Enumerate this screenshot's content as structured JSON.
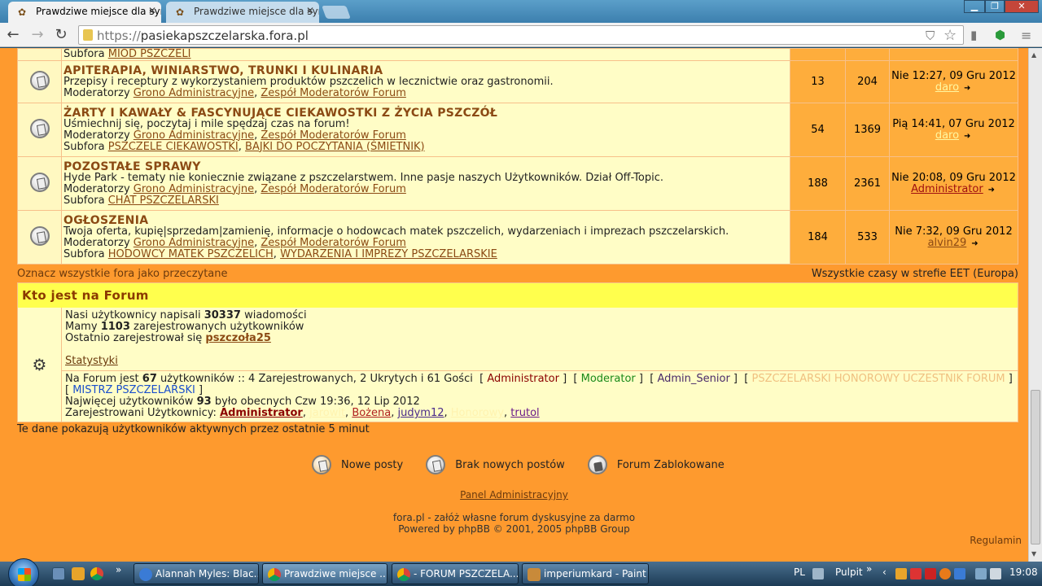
{
  "browser": {
    "tabs": [
      {
        "title": "Prawdziwe miejsce dla syn",
        "active": true
      },
      {
        "title": "Prawdziwe miejsce dla syn",
        "active": false
      }
    ],
    "url_proto": "https://",
    "url_host": "pasiekapszczelarska.fora.pl"
  },
  "forum": {
    "top_partial": {
      "label": "Subfora",
      "sub": "MIÓD PSZCZELI"
    },
    "rows": [
      {
        "title": "APITERAPIA, WINIARSTWO, TRUNKI I KULINARIA",
        "desc": "Przepisy i receptury z wykorzystaniem produktów pszczelich w lecznictwie oraz gastronomii.",
        "mod_label": "Moderatorzy",
        "mods": [
          "Grono Administracyjne",
          "Zespół Moderatorów Forum"
        ],
        "topics": "13",
        "posts": "204",
        "last_date": "Nie 12:27, 09 Gru 2012",
        "last_user": "daro",
        "last_user_color": "#fff7a0"
      },
      {
        "title": "ŻARTY I KAWAŁY & FASCYNUJĄCE CIEKAWOSTKI Z ŻYCIA PSZCZÓŁ",
        "desc": "Uśmiechnij się, poczytaj i mile spędzaj czas na forum!",
        "mod_label": "Moderatorzy",
        "mods": [
          "Grono Administracyjne",
          "Zespół Moderatorów Forum"
        ],
        "sub_label": "Subfora",
        "subs": [
          "PSZCZELE CIEKAWOSTKI",
          "BAJKI DO POCZYTANIA (ŚMIETNIK)"
        ],
        "topics": "54",
        "posts": "1369",
        "last_date": "Pią 14:41, 07 Gru 2012",
        "last_user": "daro",
        "last_user_color": "#fff7a0"
      },
      {
        "title": "POZOSTAŁE SPRAWY",
        "desc": "Hyde Park - tematy nie koniecznie związane z pszczelarstwem. Inne pasje naszych Użytkowników. Dział Off-Topic.",
        "mod_label": "Moderatorzy",
        "mods": [
          "Grono Administracyjne",
          "Zespół Moderatorów Forum"
        ],
        "sub_label": "Subfora",
        "subs": [
          "CHAT PSZCZELARSKI"
        ],
        "topics": "188",
        "posts": "2361",
        "last_date": "Nie 20:08, 09 Gru 2012",
        "last_user": "Administrator",
        "last_user_color": "#a01010"
      },
      {
        "title": "OGŁOSZENIA",
        "desc": "Twoja oferta, kupię|sprzedam|zamienię, informacje o hodowcach matek pszczelich, wydarzeniach i imprezach pszczelarskich.",
        "mod_label": "Moderatorzy",
        "mods": [
          "Grono Administracyjne",
          "Zespół Moderatorów Forum"
        ],
        "sub_label": "Subfora",
        "subs": [
          "HODOWCY MATEK PSZCZELICH",
          "WYDARZENIA I IMPREZY PSZCZELARSKIE"
        ],
        "topics": "184",
        "posts": "533",
        "last_date": "Nie 7:32, 09 Gru 2012",
        "last_user": "alvin29",
        "last_user_color": "#8b4a14"
      }
    ],
    "mark_all": "Oznacz wszystkie fora jako przeczytane",
    "timezone": "Wszystkie czasy w strefie EET (Europa)"
  },
  "who": {
    "heading": "Kto jest na Forum",
    "posts_pre": "Nasi użytkownicy napisali",
    "posts_count": "30337",
    "posts_post": "wiadomości",
    "users_pre": "Mamy",
    "users_count": "1103",
    "users_post": "zarejestrowanych użytkowników",
    "newest_pre": "Ostatnio zarejestrował się",
    "newest_user": "pszczoła25",
    "stats_link": "Statystyki",
    "online_pre": "Na Forum jest",
    "online_count": "67",
    "online_post": "użytkowników :: 4 Zarejestrowanych, 2 Ukrytych i 61 Gości",
    "groups": {
      "admin": "Administrator",
      "mod": "Moderator",
      "senior": "Admin_Senior",
      "ghost": "PSZCZELARSKI HONOROWY UCZESTNIK FORUM",
      "master": "MISTRZ PSZCZELARSKI"
    },
    "record_pre": "Najwięcej użytkowników",
    "record_count": "93",
    "record_post": "było obecnych Czw 19:36, 12 Lip 2012",
    "registered_label": "Zarejestrowani Użytkownicy:",
    "registered": {
      "admin": "Administrator",
      "ghost1": "jarowit",
      "boz": "Bożena",
      "jud": "judym12",
      "ghost2": "Honorowy",
      "trut": "trutol"
    },
    "active_note": "Te dane pokazują użytkowników aktywnych przez ostatnie 5 minut"
  },
  "legend": {
    "new_posts": "Nowe posty",
    "no_new_posts": "Brak nowych postów",
    "locked": "Forum Zablokowane"
  },
  "footer": {
    "admin_panel": "Panel Administracyjny",
    "line1": "fora.pl - załóż własne forum dyskusyjne za darmo",
    "line2": "Powered by phpBB © 2001, 2005 phpBB Group",
    "rules": "Regulamin"
  },
  "taskbar": {
    "items": [
      {
        "label": "Alannah Myles: Blac...",
        "active": false
      },
      {
        "label": "Prawdziwe miejsce ...",
        "active": true
      },
      {
        "label": "- FORUM PSZCZELA...",
        "active": false
      },
      {
        "label": "imperiumkard - Paint",
        "active": false
      }
    ],
    "lang": "PL",
    "desktop": "Pulpit",
    "clock": "19:08"
  },
  "colors": {
    "page_bg": "#fe9a2e",
    "cell_bg": "#fffdc6",
    "title": "#a44a00",
    "header_yellow": "#ffff4d"
  }
}
